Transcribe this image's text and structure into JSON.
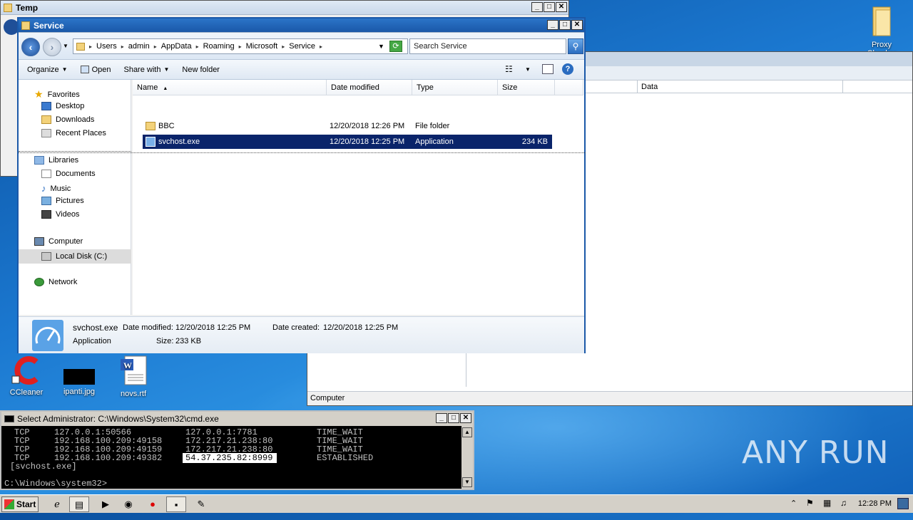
{
  "temp_window": {
    "title": "Temp"
  },
  "registry_window": {
    "column_data": "Data",
    "status_path": "Computer"
  },
  "explorer": {
    "title": "Service",
    "breadcrumbs": [
      "Users",
      "admin",
      "AppData",
      "Roaming",
      "Microsoft",
      "Service"
    ],
    "search_placeholder": "Search Service",
    "toolbar": {
      "organize": "Organize",
      "open": "Open",
      "share_with": "Share with",
      "new_folder": "New folder"
    },
    "nav": {
      "favorites": "Favorites",
      "desktop": "Desktop",
      "downloads": "Downloads",
      "recent_places": "Recent Places",
      "libraries": "Libraries",
      "documents": "Documents",
      "music": "Music",
      "pictures": "Pictures",
      "videos": "Videos",
      "computer": "Computer",
      "local_disk": "Local Disk (C:)",
      "network": "Network"
    },
    "columns": {
      "name": "Name",
      "date": "Date modified",
      "type": "Type",
      "size": "Size"
    },
    "files": [
      {
        "name": "BBC",
        "date": "12/20/2018 12:26 PM",
        "type": "File folder",
        "size": ""
      },
      {
        "name": "svchost.exe",
        "date": "12/20/2018 12:25 PM",
        "type": "Application",
        "size": "234 KB"
      }
    ],
    "details": {
      "name": "svchost.exe",
      "type": "Application",
      "date_modified_label": "Date modified:",
      "date_modified": "12/20/2018 12:25 PM",
      "size_label": "Size:",
      "size": "233 KB",
      "date_created_label": "Date created:",
      "date_created": "12/20/2018 12:25 PM"
    }
  },
  "desktop_icons": {
    "proxy_checker": "Proxy Checker",
    "ccleaner": "CCleaner",
    "ipanti": "ipanti.jpg",
    "novs": "novs.rtf"
  },
  "cmd": {
    "title": "Select Administrator: C:\\Windows\\System32\\cmd.exe",
    "lines": [
      {
        "proto": "TCP",
        "local": "127.0.0.1:50566",
        "foreign": "127.0.0.1:7781",
        "state": "TIME_WAIT"
      },
      {
        "proto": "TCP",
        "local": "192.168.100.209:49158",
        "foreign": "172.217.21.238:80",
        "state": "TIME_WAIT"
      },
      {
        "proto": "TCP",
        "local": "192.168.100.209:49159",
        "foreign": "172.217.21.238:80",
        "state": "TIME_WAIT"
      },
      {
        "proto": "TCP",
        "local": "192.168.100.209:49382",
        "foreign": "54.37.235.82:8999",
        "state": "ESTABLISHED"
      }
    ],
    "process": "[svchost.exe]",
    "prompt": "C:\\Windows\\system32>"
  },
  "taskbar": {
    "start": "Start",
    "clock": "12:28 PM"
  },
  "watermark": "ANY RUN",
  "colors": {
    "selection": "#0a246a",
    "title_active": "#1a58a8",
    "desktop": "#1b78d0"
  }
}
